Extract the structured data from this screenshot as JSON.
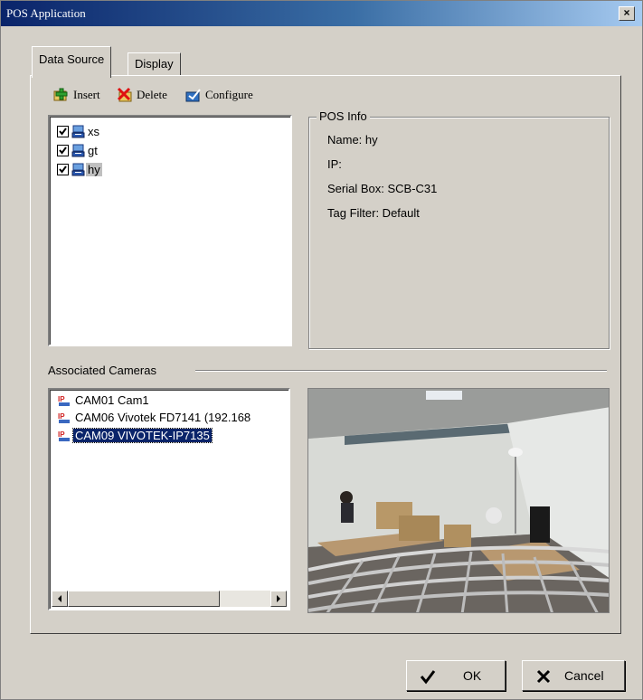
{
  "window": {
    "title": "POS Application",
    "close_label": "×"
  },
  "tabs": [
    {
      "label": "Data Source",
      "active": true
    },
    {
      "label": "Display",
      "active": false
    }
  ],
  "toolbar": {
    "insert_label": "Insert",
    "delete_label": "Delete",
    "configure_label": "Configure"
  },
  "pos_list": [
    {
      "label": "xs",
      "checked": true,
      "selected": false
    },
    {
      "label": "gt",
      "checked": true,
      "selected": false
    },
    {
      "label": "hy",
      "checked": true,
      "selected": true
    }
  ],
  "pos_info": {
    "legend": "POS Info",
    "name": "Name: hy",
    "ip": "IP:",
    "serial_box": "Serial Box: SCB-C31",
    "tag_filter": "Tag Filter: Default"
  },
  "associated_cameras": {
    "label": "Associated Cameras",
    "items": [
      {
        "label": "CAM01 Cam1",
        "selected": false
      },
      {
        "label": "CAM06 Vivotek FD7141 (192.168",
        "selected": false
      },
      {
        "label": "CAM09 VIVOTEK-IP7135",
        "selected": true
      }
    ]
  },
  "buttons": {
    "ok_label": "OK",
    "cancel_label": "Cancel"
  },
  "colors": {
    "title_start": "#0a246a",
    "title_end": "#a6caf0",
    "selection": "#0a246a",
    "face": "#d4d0c8"
  }
}
